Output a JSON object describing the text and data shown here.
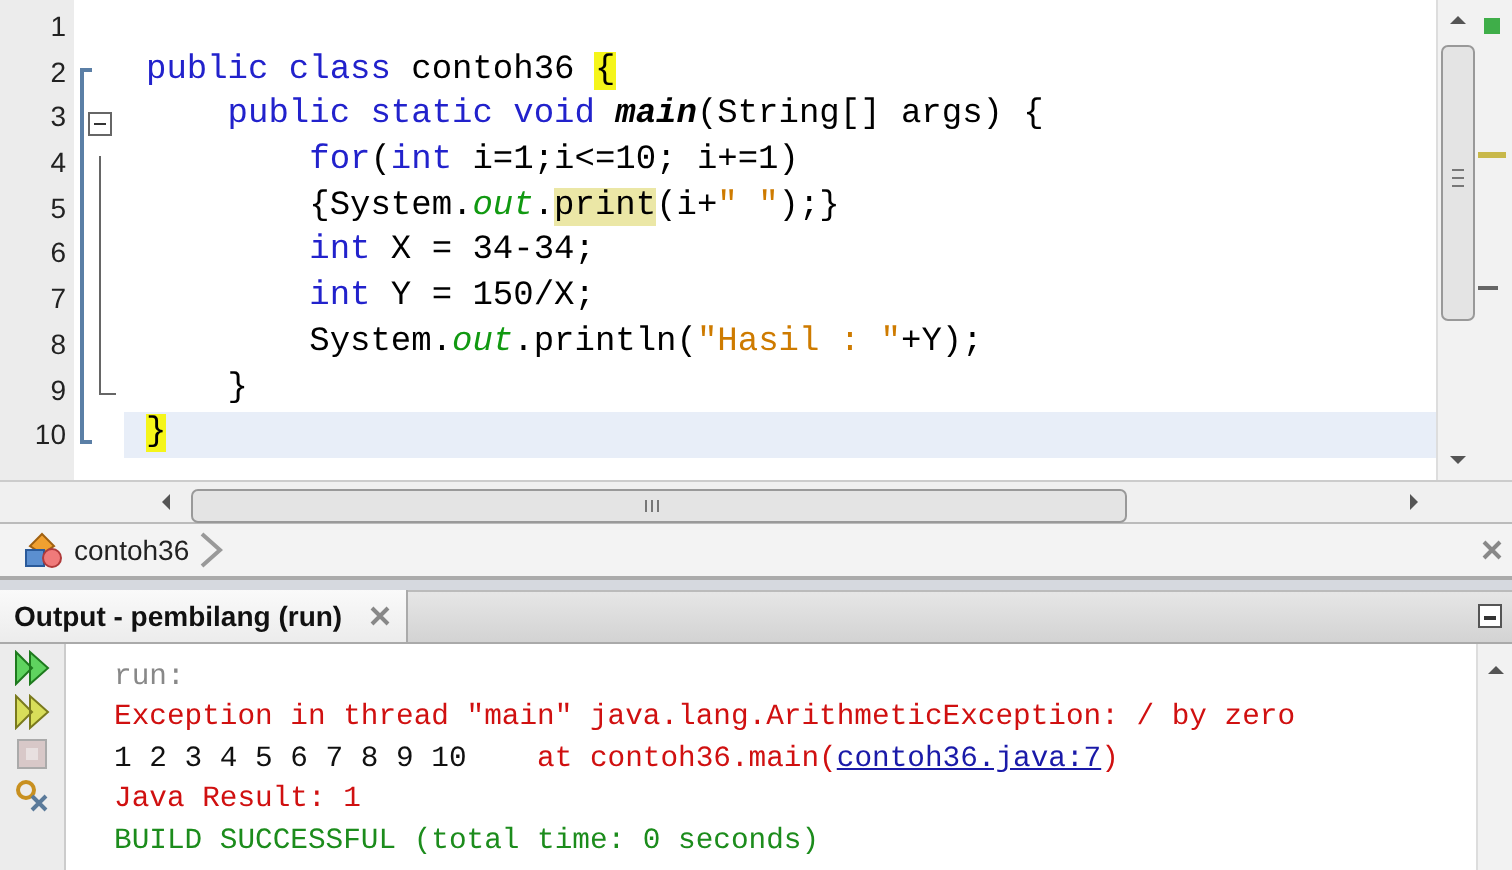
{
  "editor": {
    "lines": [
      {
        "number": "1",
        "current": false
      },
      {
        "number": "2",
        "current": false,
        "tokens": [
          {
            "text": "public class",
            "kind": "keyword"
          },
          {
            "text": " contoh36 ",
            "kind": "plain"
          },
          {
            "text": "{",
            "kind": "brace-match"
          }
        ]
      },
      {
        "number": "3",
        "current": false,
        "tokens": [
          {
            "text": "    public static void ",
            "kind": "keyword"
          },
          {
            "text": "main",
            "kind": "method"
          },
          {
            "text": "(String[] args) {",
            "kind": "plain"
          }
        ]
      },
      {
        "number": "4",
        "current": false,
        "tokens": [
          {
            "text": "        for",
            "kind": "keyword"
          },
          {
            "text": "(",
            "kind": "plain"
          },
          {
            "text": "int",
            "kind": "keyword"
          },
          {
            "text": " i=1;i<=10; i+=1)",
            "kind": "plain"
          }
        ]
      },
      {
        "number": "5",
        "current": false,
        "tokens": [
          {
            "text": "        {System.",
            "kind": "plain"
          },
          {
            "text": "out",
            "kind": "field"
          },
          {
            "text": ".",
            "kind": "plain"
          },
          {
            "text": "print",
            "kind": "occurrence"
          },
          {
            "text": "(i+",
            "kind": "plain"
          },
          {
            "text": "\" \"",
            "kind": "string"
          },
          {
            "text": ");}",
            "kind": "plain"
          }
        ]
      },
      {
        "number": "6",
        "current": false,
        "tokens": [
          {
            "text": "        int",
            "kind": "keyword"
          },
          {
            "text": " X = 34-34;",
            "kind": "plain"
          }
        ]
      },
      {
        "number": "7",
        "current": false,
        "tokens": [
          {
            "text": "        int",
            "kind": "keyword"
          },
          {
            "text": " Y = 150/X;",
            "kind": "plain"
          }
        ]
      },
      {
        "number": "8",
        "current": false,
        "tokens": [
          {
            "text": "        System.",
            "kind": "plain"
          },
          {
            "text": "out",
            "kind": "field"
          },
          {
            "text": ".println(",
            "kind": "plain"
          },
          {
            "text": "\"Hasil : \"",
            "kind": "string"
          },
          {
            "text": "+Y);",
            "kind": "plain"
          }
        ]
      },
      {
        "number": "9",
        "current": false,
        "tokens": [
          {
            "text": "    }",
            "kind": "plain"
          }
        ]
      },
      {
        "number": "10",
        "current": true,
        "tokens": [
          {
            "text": "}",
            "kind": "brace-match"
          }
        ]
      }
    ]
  },
  "breadcrumb": {
    "label": "contoh36"
  },
  "output": {
    "tab": {
      "title": "Output - pembilang (run)",
      "selected": true
    },
    "lines": [
      {
        "segments": [
          {
            "text": "run:",
            "kind": "info"
          }
        ]
      },
      {
        "segments": [
          {
            "text": "Exception in thread \"main\" java.lang.ArithmeticException: / by zero",
            "kind": "error"
          }
        ]
      },
      {
        "segments": [
          {
            "text": "1 2 3 4 5 6 7 8 9 10",
            "kind": "stdout"
          },
          {
            "text": "    at contoh36.main(",
            "kind": "error"
          },
          {
            "text": "contoh36.java:7",
            "kind": "link"
          },
          {
            "text": ")",
            "kind": "error"
          }
        ]
      },
      {
        "segments": [
          {
            "text": "Java Result: 1",
            "kind": "error"
          }
        ]
      },
      {
        "segments": [
          {
            "text": "BUILD SUCCESSFUL (total time: 0 seconds)",
            "kind": "success"
          }
        ]
      }
    ]
  }
}
